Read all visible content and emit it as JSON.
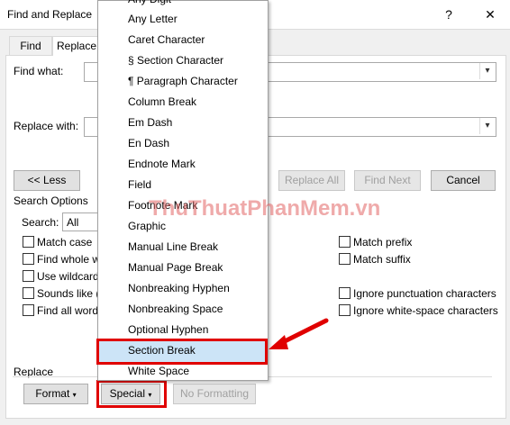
{
  "window": {
    "title": "Find and Replace",
    "help_symbol": "?",
    "close_symbol": "✕"
  },
  "tabs": {
    "find": "Find",
    "replace": "Replace"
  },
  "find_what": {
    "label": "Find what:"
  },
  "replace_with": {
    "label": "Replace with:"
  },
  "buttons": {
    "less": "<< Less",
    "replace_all": "Replace All",
    "find_next": "Find Next",
    "cancel": "Cancel",
    "format": "Format",
    "special": "Special",
    "no_formatting": "No Formatting"
  },
  "search_options": {
    "heading": "Search Options",
    "search_label": "Search:",
    "search_value": "All",
    "left_checks": [
      "Match case",
      "Find whole w",
      "Use wildcard",
      "Sounds like (",
      "Find all word"
    ],
    "right_checks": [
      "Match prefix",
      "Match suffix",
      "Ignore punctuation characters",
      "Ignore white-space characters"
    ]
  },
  "replace_section": {
    "heading": "Replace"
  },
  "special_menu": {
    "items": [
      "Any Digit",
      "Any Letter",
      "Caret Character",
      "§ Section Character",
      "¶ Paragraph Character",
      "Column Break",
      "Em Dash",
      "En Dash",
      "Endnote Mark",
      "Field",
      "Footnote Mark",
      "Graphic",
      "Manual Line Break",
      "Manual Page Break",
      "Nonbreaking Hyphen",
      "Nonbreaking Space",
      "Optional Hyphen",
      "Section Break",
      "White Space"
    ],
    "selected": "Section Break"
  },
  "watermark": "ThuThuatPhanMem.vn",
  "colors": {
    "highlight": "#cce4f7",
    "annotation_red": "#e00000"
  }
}
